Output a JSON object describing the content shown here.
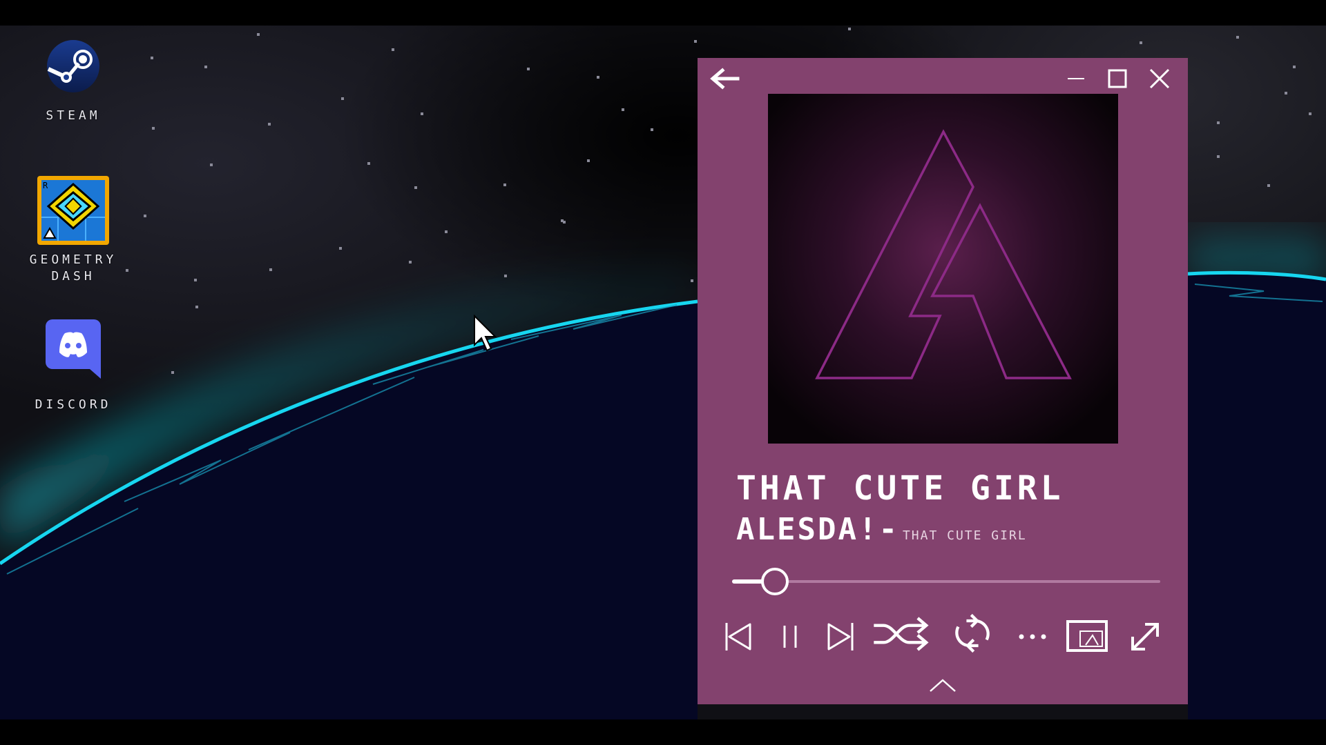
{
  "desktop": {
    "icons": [
      {
        "label": "STEAM",
        "icon": "steam-icon"
      },
      {
        "label": "GEOMETRY DASH",
        "icon": "geometry-dash-icon"
      },
      {
        "label": "DISCORD",
        "icon": "discord-icon"
      }
    ]
  },
  "player": {
    "window_controls": [
      "back-arrow-icon",
      "minimize-icon",
      "maximize-icon",
      "close-icon"
    ],
    "track": {
      "title": "THAT CUTE GIRL",
      "artist": "ALESDA!",
      "separator": "-",
      "album": "THAT CUTE GIRL"
    },
    "progress_fraction": 0.1,
    "controls": [
      "previous-icon",
      "pause-icon",
      "next-icon",
      "shuffle-icon",
      "repeat-icon",
      "more-icon",
      "mini-player-icon",
      "fullscreen-icon"
    ],
    "expand": "chevron-up-icon"
  },
  "colors": {
    "player_bg": "#83426e",
    "accent_cyan": "#17d6f0",
    "cover_outline": "#8c2a86"
  }
}
